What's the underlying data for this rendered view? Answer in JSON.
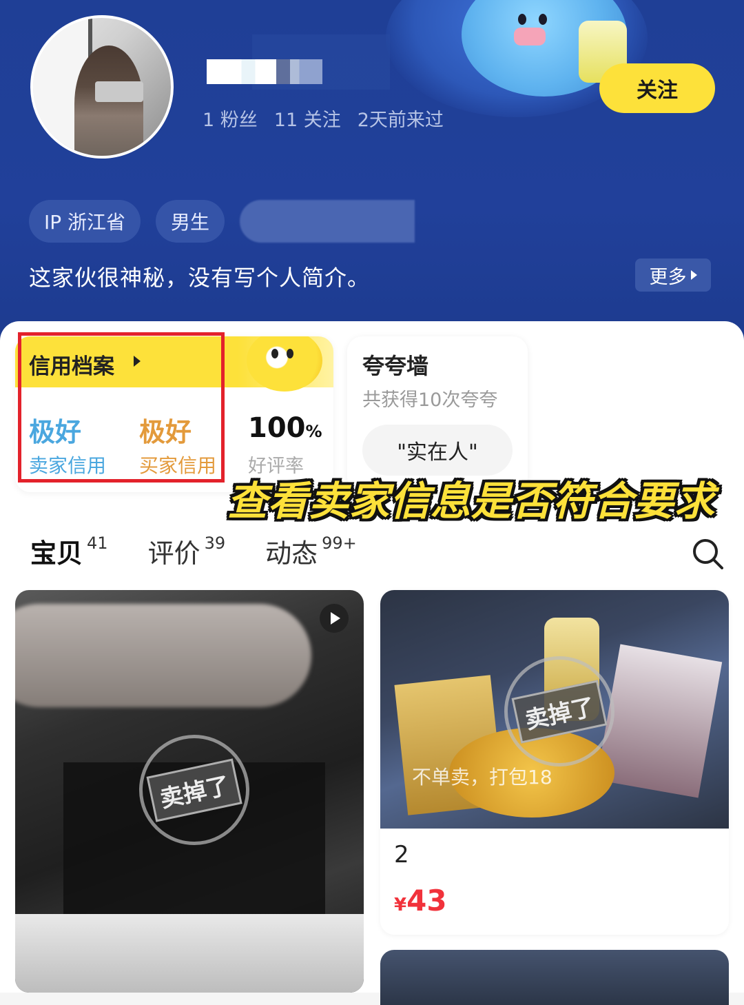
{
  "profile": {
    "stats": [
      "1 粉丝",
      "11 关注",
      "2天前来过"
    ],
    "follow_label": "关注",
    "tags": [
      "IP 浙江省",
      "男生"
    ],
    "bio": "这家伙很神秘，没有写个人简介。",
    "more_label": "更多"
  },
  "credit": {
    "title": "信用档案",
    "seller_value": "极好",
    "seller_label": "卖家信用",
    "buyer_value": "极好",
    "buyer_label": "买家信用",
    "rate_value": "100",
    "rate_unit": "%",
    "rate_label": "好评率"
  },
  "praise": {
    "title": "夸夸墙",
    "subtitle": "共获得10次夸夸",
    "tag": "\"实在人\""
  },
  "overlay_text": "查看卖家信息是否符合要求",
  "tabs": [
    {
      "label": "宝贝",
      "count": "41"
    },
    {
      "label": "评价",
      "count": "39"
    },
    {
      "label": "动态",
      "count": "99+"
    }
  ],
  "products": {
    "stamp": "卖掉了",
    "p2_caption": "不单卖，打包18",
    "p2_title": "2",
    "p2_price_symbol": "¥",
    "p2_price": "43"
  },
  "colors": {
    "header_bg": "#21409a",
    "accent_yellow": "#fde13a",
    "seller_blue": "#4aa7df",
    "buyer_orange": "#e39a3b",
    "price_red": "#f1323b",
    "highlight_red": "#e3222b"
  }
}
